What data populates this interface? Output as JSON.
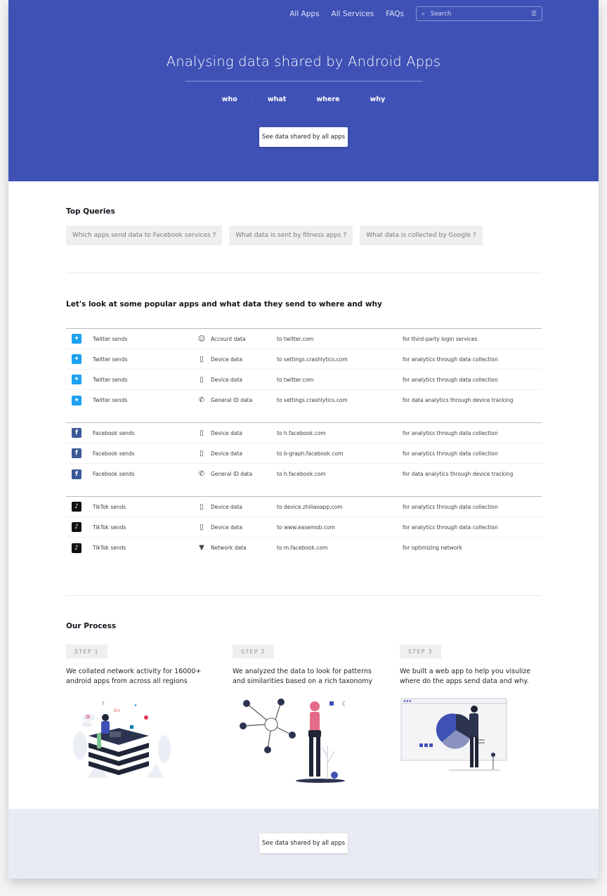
{
  "nav": {
    "links": [
      "All Apps",
      "All Services",
      "FAQs"
    ],
    "search_placeholder": "Search"
  },
  "hero": {
    "title": "Analysing data shared by Android Apps",
    "tags": [
      "who",
      "what",
      "where",
      "why"
    ],
    "separator": ".",
    "button": "See data shared by all apps"
  },
  "top_queries": {
    "heading": "Top Queries",
    "items": [
      "Which apps send data to Facebook services ?",
      "What data is sent by fitness apps ?",
      "What data is collected by Google ?"
    ]
  },
  "popular": {
    "heading": "Let's look at some popular apps and what data they send to where and why",
    "groups": [
      {
        "app": "twitter",
        "rows": [
          {
            "app": "Twitter sends",
            "icon": "account-icon",
            "type": "Account data",
            "dest": "to twitter.com",
            "why": "for third-party login services"
          },
          {
            "app": "Twitter sends",
            "icon": "device-icon",
            "type": "Device data",
            "dest": "to settings.crashlytics.com",
            "why": "for analytics through data collection"
          },
          {
            "app": "Twitter sends",
            "icon": "device-icon",
            "type": "Device data",
            "dest": "to twitter.com",
            "why": "for analytics through data collection"
          },
          {
            "app": "Twitter sends",
            "icon": "phone-icon",
            "type": "General ID data",
            "dest": "to settings.crashlytics.com",
            "why": "for data analytics through device tracking"
          }
        ]
      },
      {
        "app": "facebook",
        "rows": [
          {
            "app": "Facebook sends",
            "icon": "device-icon",
            "type": "Device data",
            "dest": "to h.facebook.com",
            "why": "for analytics through data collection"
          },
          {
            "app": "Facebook sends",
            "icon": "device-icon",
            "type": "Device data",
            "dest": "to b-graph.facebook.com",
            "why": "for analytics through data collection"
          },
          {
            "app": "Facebook sends",
            "icon": "phone-icon",
            "type": "General ID data",
            "dest": "to h.facebook.com",
            "why": "for data analytics through device tracking"
          }
        ]
      },
      {
        "app": "tiktok",
        "rows": [
          {
            "app": "TikTok sends",
            "icon": "device-icon",
            "type": "Device data",
            "dest": "to device.zhiliaoapp.com",
            "why": "for analytics through data collection"
          },
          {
            "app": "TikTok sends",
            "icon": "device-icon",
            "type": "Device data",
            "dest": "to www.easemob.com",
            "why": "for analytics through data collection"
          },
          {
            "app": "TikTok sends",
            "icon": "wifi-icon",
            "type": "Network data",
            "dest": "to m.facebook.com",
            "why": "for optimizing network"
          }
        ]
      }
    ]
  },
  "process": {
    "heading": "Our Process",
    "steps": [
      {
        "label": "STEP 1",
        "text": "We collated network activity for 16000+ android apps from across all regions"
      },
      {
        "label": "STEP 2",
        "text": "We analyzed the data to look for patterns and similarities based on a rich taxonomy"
      },
      {
        "label": "STEP 3",
        "text": "We built a web app to help you visulize where do the apps send data and why."
      }
    ]
  },
  "footer": {
    "button": "See data shared by all apps"
  },
  "colors": {
    "hero": "#3f51b5",
    "footer": "#e9ebf4",
    "twitter": "#1da1f2",
    "facebook": "#3b5998",
    "tiktok": "#111111"
  }
}
